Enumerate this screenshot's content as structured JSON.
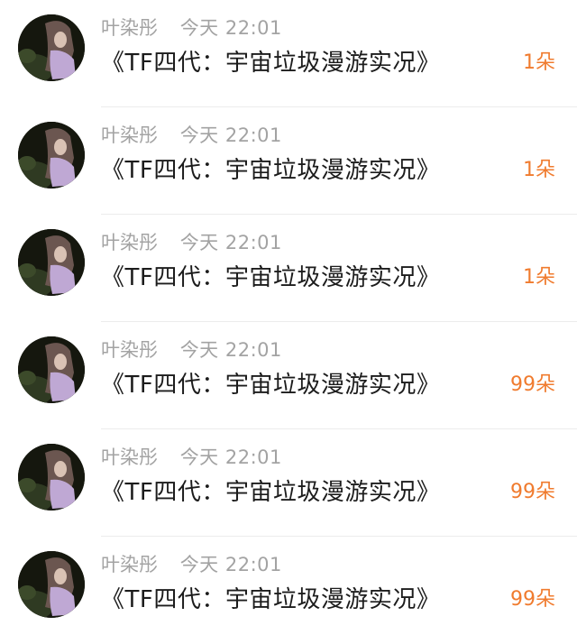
{
  "gift_list": {
    "items": [
      {
        "name": "叶染彤",
        "time": "今天 22:01",
        "title": "《TF四代：宇宙垃圾漫游实况》",
        "amount": "1朵"
      },
      {
        "name": "叶染彤",
        "time": "今天 22:01",
        "title": "《TF四代：宇宙垃圾漫游实况》",
        "amount": "1朵"
      },
      {
        "name": "叶染彤",
        "time": "今天 22:01",
        "title": "《TF四代：宇宙垃圾漫游实况》",
        "amount": "1朵"
      },
      {
        "name": "叶染彤",
        "time": "今天 22:01",
        "title": "《TF四代：宇宙垃圾漫游实况》",
        "amount": "99朵"
      },
      {
        "name": "叶染彤",
        "time": "今天 22:01",
        "title": "《TF四代：宇宙垃圾漫游实况》",
        "amount": "99朵"
      },
      {
        "name": "叶染彤",
        "time": "今天 22:01",
        "title": "《TF四代：宇宙垃圾漫游实况》",
        "amount": "99朵"
      }
    ]
  },
  "colors": {
    "amount_accent": "#f07b2e",
    "meta_text": "#a3a3a3",
    "title_text": "#1c1c1c",
    "divider": "#ececec"
  },
  "icons": {
    "avatar": "user-avatar-photo"
  }
}
